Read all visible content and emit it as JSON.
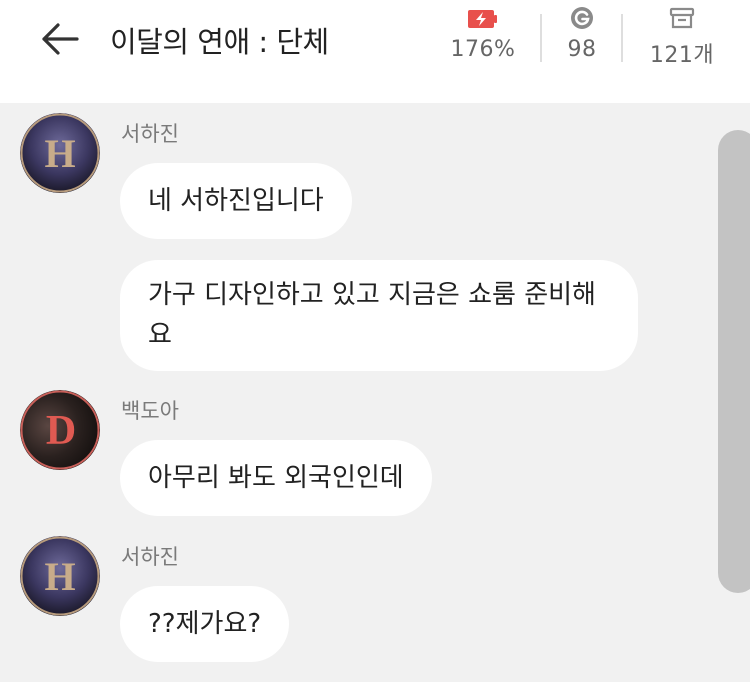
{
  "header": {
    "title": "이달의 연애 : 단체",
    "back_icon": "arrow-left-icon",
    "stats": [
      {
        "icon": "battery-charging-icon",
        "value": "176%",
        "color": "#e8504c"
      },
      {
        "icon": "g-coin-icon",
        "value": "98",
        "color": "#8a8a8a"
      },
      {
        "icon": "archive-box-icon",
        "value": "121개",
        "color": "#8a8a8a"
      }
    ]
  },
  "colors": {
    "background": "#f1f1f1",
    "bubble": "#ffffff",
    "avatar_h_letter": "#c8ac8a",
    "avatar_d_letter": "#e05a52"
  },
  "messages": [
    {
      "sender": "서하진",
      "avatar_letter": "H",
      "bubbles": [
        "네 서하진입니다",
        "가구 디자인하고 있고 지금은 쇼룸 준비해요"
      ]
    },
    {
      "sender": "백도아",
      "avatar_letter": "D",
      "bubbles": [
        "아무리 봐도 외국인인데"
      ]
    },
    {
      "sender": "서하진",
      "avatar_letter": "H",
      "bubbles": [
        "??제가요?"
      ]
    }
  ]
}
